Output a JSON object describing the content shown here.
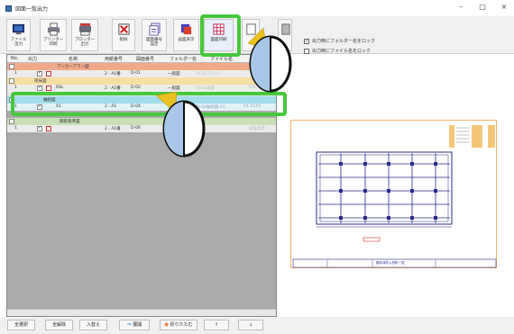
{
  "window": {
    "title": "図面一覧出力",
    "minimize": "–",
    "maximize": "□",
    "close": "×"
  },
  "toolbar": {
    "file_output": "ファイル\n出力",
    "printer_print": "プリンター\n印刷",
    "plotter_output": "プロッター\n出力",
    "delete": "削除",
    "drawing_number_settings": "図面番号\n設定",
    "screen_display": "画面表示",
    "drawing_print": "図面印刷"
  },
  "options": {
    "folder_name_lock": "出力時にフォルダー名をロック",
    "file_name_lock": "出力時にファイル名をロック"
  },
  "grid": {
    "columns": {
      "no": "No.",
      "output": "出力",
      "name": "名称",
      "paper": "用紙番号",
      "drawing_number": "図面番号",
      "folder": "フォルダー名",
      "file": "ファイル名"
    },
    "groups": [
      {
        "name": "アンカーアラン図",
        "color": "#f2a98a"
      },
      {
        "name": "梁床図",
        "color": "#f7dea1"
      },
      {
        "name": "軸組図",
        "color": "#a5dcea"
      },
      {
        "name": "鋼管基準図",
        "color": "#c9dfb6"
      }
    ],
    "rows": [
      {
        "no": "1",
        "name": "",
        "paper": "2 - A1番",
        "drawing_number": "D-01",
        "folder": "一般図",
        "file": "D-01アンカー"
      },
      {
        "no": "1",
        "name": "RSL",
        "paper": "2 - A1番",
        "drawing_number": "D-02",
        "folder": "一般図",
        "file": "D-02床図",
        "extra": "RSL"
      },
      {
        "no": "1",
        "name": "X1",
        "paper": "2 - A1",
        "drawing_number": "D-04",
        "folder": "一般図",
        "file": "D-04軸組図-X1",
        "extra": "X1 X2X3"
      },
      {
        "no": "1",
        "name": "",
        "paper": "2 - A1番",
        "drawing_number": "D-06",
        "folder": "一般図",
        "file": "",
        "extra": "鋼管基準"
      }
    ]
  },
  "bottom": {
    "select_all": "全選択",
    "deselect_all": "全解除",
    "swap": "入替え",
    "expand": "展開",
    "collapse": "折りたたむ",
    "up": "↑",
    "down": "↓"
  },
  "preview": {
    "title_block": "鋼本体防火材料一覧"
  }
}
